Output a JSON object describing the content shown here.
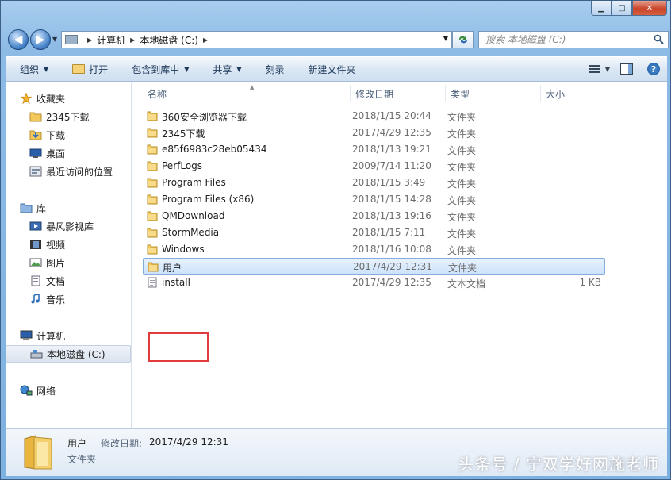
{
  "window": {
    "title": "",
    "controls": {
      "minimize": "▁",
      "maximize": "□",
      "close": "✕"
    }
  },
  "nav": {
    "back_label": "◀",
    "forward_label": "▶",
    "address": {
      "crumbs": [
        "计算机",
        "本地磁盘 (C:)"
      ]
    },
    "search_placeholder": "搜索 本地磁盘 (C:)"
  },
  "toolbar": {
    "organize": "组织",
    "open": "打开",
    "include_in_library": "包含到库中",
    "share": "共享",
    "burn": "刻录",
    "new_folder": "新建文件夹"
  },
  "sidebar": {
    "favorites": {
      "label": "收藏夹",
      "items": [
        "2345下载",
        "下载",
        "桌面",
        "最近访问的位置"
      ]
    },
    "libraries": {
      "label": "库",
      "items": [
        "暴风影视库",
        "视频",
        "图片",
        "文档",
        "音乐"
      ]
    },
    "computer": {
      "label": "计算机",
      "items": [
        "本地磁盘 (C:)"
      ]
    },
    "network": {
      "label": "网络"
    }
  },
  "columns": {
    "name": "名称",
    "date": "修改日期",
    "type": "类型",
    "size": "大小"
  },
  "files": [
    {
      "name": "360安全浏览器下载",
      "date": "2018/1/15 20:44",
      "type": "文件夹",
      "size": "",
      "kind": "folder"
    },
    {
      "name": "2345下载",
      "date": "2017/4/29 12:35",
      "type": "文件夹",
      "size": "",
      "kind": "folder"
    },
    {
      "name": "e85f6983c28eb05434",
      "date": "2018/1/13 19:21",
      "type": "文件夹",
      "size": "",
      "kind": "folder"
    },
    {
      "name": "PerfLogs",
      "date": "2009/7/14 11:20",
      "type": "文件夹",
      "size": "",
      "kind": "folder"
    },
    {
      "name": "Program Files",
      "date": "2018/1/15 3:49",
      "type": "文件夹",
      "size": "",
      "kind": "folder"
    },
    {
      "name": "Program Files (x86)",
      "date": "2018/1/15 14:28",
      "type": "文件夹",
      "size": "",
      "kind": "folder"
    },
    {
      "name": "QMDownload",
      "date": "2018/1/13 19:16",
      "type": "文件夹",
      "size": "",
      "kind": "folder"
    },
    {
      "name": "StormMedia",
      "date": "2018/1/15 7:11",
      "type": "文件夹",
      "size": "",
      "kind": "folder"
    },
    {
      "name": "Windows",
      "date": "2018/1/16 10:08",
      "type": "文件夹",
      "size": "",
      "kind": "folder"
    },
    {
      "name": "用户",
      "date": "2017/4/29 12:31",
      "type": "文件夹",
      "size": "",
      "kind": "folder",
      "selected": true
    },
    {
      "name": "install",
      "date": "2017/4/29 12:35",
      "type": "文本文档",
      "size": "1 KB",
      "kind": "text"
    }
  ],
  "details": {
    "name": "用户",
    "modified_label": "修改日期:",
    "modified": "2017/4/29 12:31",
    "type": "文件夹"
  },
  "watermark": "头条号 / 宁双学好网施老师",
  "colors": {
    "selection": "#cde3fb",
    "highlight_box": "#e23b3b",
    "folder": "#f2c75c"
  }
}
